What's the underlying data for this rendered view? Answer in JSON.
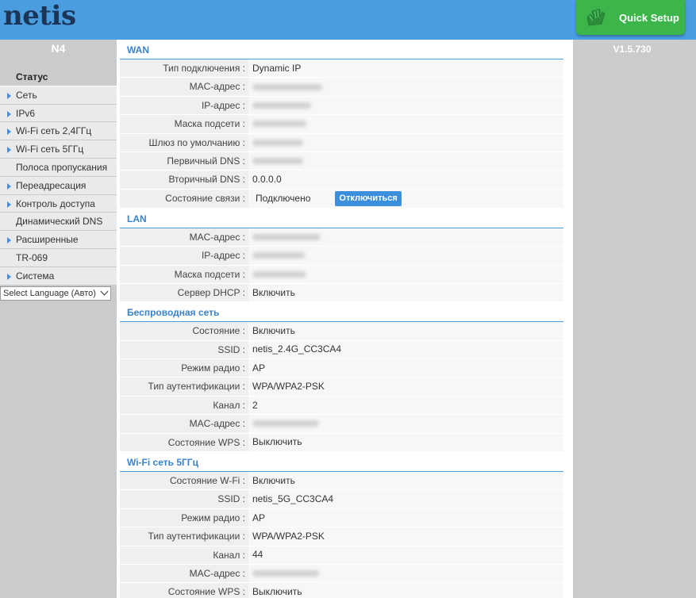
{
  "header": {
    "logo": "netis",
    "quick_setup": "Quick Setup"
  },
  "sidebar": {
    "model": "N4",
    "items": [
      {
        "label": "Статус",
        "active": true,
        "arrow": false
      },
      {
        "label": "Сеть",
        "arrow": true
      },
      {
        "label": "IPv6",
        "arrow": true
      },
      {
        "label": "Wi-Fi сеть 2,4ГГц",
        "arrow": true
      },
      {
        "label": "Wi-Fi сеть 5ГГц",
        "arrow": true
      },
      {
        "label": "Полоса пропускания",
        "arrow": false
      },
      {
        "label": "Переадресация",
        "arrow": true
      },
      {
        "label": "Контроль доступа",
        "arrow": true
      },
      {
        "label": "Динамический DNS",
        "arrow": false
      },
      {
        "label": "Расширенные",
        "arrow": true
      },
      {
        "label": "TR-069",
        "arrow": false
      },
      {
        "label": "Система",
        "arrow": true
      }
    ],
    "language": "Select Language (Авто)"
  },
  "version": "V1.5.730",
  "wan": {
    "title": "WAN",
    "rows": [
      {
        "label": "Тип подключения :",
        "value": "Dynamic IP"
      },
      {
        "label": "MAC-адрес :",
        "value": "",
        "blurred": true
      },
      {
        "label": "IP-адрес :",
        "value": "",
        "blurred": true
      },
      {
        "label": "Маска подсети :",
        "value": "",
        "blurred": true
      },
      {
        "label": "Шлюз по умолчанию :",
        "value": "",
        "blurred": true
      },
      {
        "label": "Первичный DNS :",
        "value": "",
        "blurred": true
      },
      {
        "label": "Вторичный DNS :",
        "value": "0.0.0.0"
      }
    ],
    "link_label": "Состояние связи :",
    "link_status": "Подключено",
    "disconnect": "Отключиться"
  },
  "lan": {
    "title": "LAN",
    "rows": [
      {
        "label": "MAC-адрес :",
        "value": "",
        "blurred": true
      },
      {
        "label": "IP-адрес :",
        "value": "",
        "blurred": true
      },
      {
        "label": "Маска подсети :",
        "value": "",
        "blurred": true
      },
      {
        "label": "Сервер DHCP :",
        "value": "Включить"
      }
    ]
  },
  "wireless": {
    "title": "Беспроводная сеть",
    "rows": [
      {
        "label": "Состояние :",
        "value": "Включить"
      },
      {
        "label": "SSID :",
        "value": "netis_2.4G_CC3CA4"
      },
      {
        "label": "Режим радио :",
        "value": "AP"
      },
      {
        "label": "Тип аутентификации :",
        "value": "WPA/WPA2-PSK"
      },
      {
        "label": "Канал :",
        "value": "2"
      },
      {
        "label": "MAC-адрес :",
        "value": "",
        "blurred": true
      },
      {
        "label": "Состояние WPS :",
        "value": "Выключить"
      }
    ]
  },
  "wifi5": {
    "title": "Wi-Fi сеть 5ГГц",
    "rows": [
      {
        "label": "Состояние W-Fi :",
        "value": "Включить"
      },
      {
        "label": "SSID :",
        "value": "netis_5G_CC3CA4"
      },
      {
        "label": "Режим радио :",
        "value": "AP"
      },
      {
        "label": "Тип аутентификации :",
        "value": "WPA/WPA2-PSK"
      },
      {
        "label": "Канал :",
        "value": "44"
      },
      {
        "label": "MAC-адрес :",
        "value": "",
        "blurred": true
      },
      {
        "label": "Состояние WPS :",
        "value": "Выключить"
      }
    ]
  },
  "colors": {
    "header": "#4a9ee0",
    "quick_setup": "#3cb54a",
    "accent": "#3a83cc",
    "sidebar": "#c9cbcd"
  }
}
